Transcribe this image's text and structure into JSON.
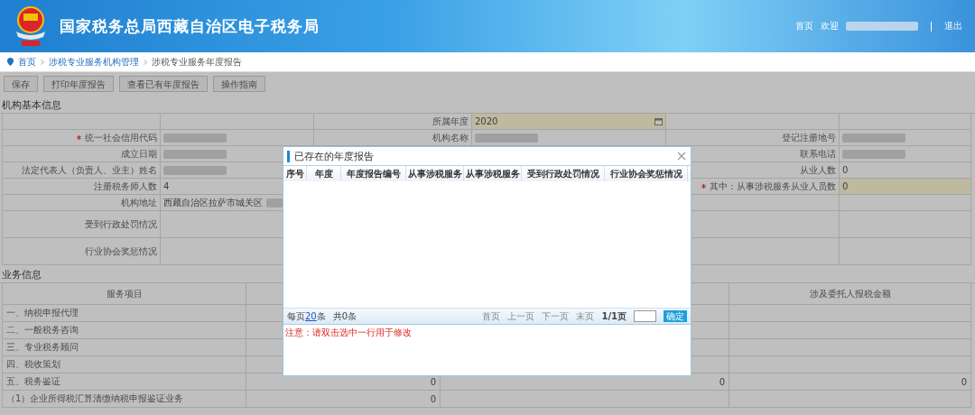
{
  "header": {
    "title": "国家税务总局西藏自治区电子税务局",
    "links": [
      {
        "label": "首页"
      },
      {
        "label": "欢迎"
      }
    ],
    "logout": "退出"
  },
  "breadcrumb": [
    {
      "label": "首页"
    },
    {
      "label": "涉税专业服务机构管理"
    },
    {
      "label": "涉税专业服务年度报告"
    }
  ],
  "toolbar": [
    {
      "label": "保存"
    },
    {
      "label": "打印年度报告"
    },
    {
      "label": "查看已有年度报告"
    },
    {
      "label": "操作指南"
    }
  ],
  "basic_info": {
    "title": "机构基本信息",
    "rows": [
      {
        "cells": [
          {},
          {
            "label": "所属年度",
            "value": "2020",
            "highlight": true,
            "calendar": true
          },
          {}
        ]
      },
      {
        "cells": [
          {
            "label": "统一社会信用代码",
            "required": true,
            "blurred": true
          },
          {
            "label": "机构名称",
            "blurred": true
          },
          {
            "label": "登记注册地号",
            "blurred": true
          }
        ]
      },
      {
        "cells": [
          {
            "label": "成立日期",
            "blurred": true
          },
          {},
          {
            "label": "联系电话",
            "blurred": true
          }
        ]
      },
      {
        "cells": [
          {
            "label": "法定代表人（负责人、业主）姓名",
            "blurred": true
          },
          {},
          {
            "label": "从业人数",
            "value": "0"
          }
        ]
      },
      {
        "cells": [
          {
            "label": "注册税务师人数",
            "value": "4"
          },
          {},
          {
            "label": "其中：从事涉税服务从业人员数",
            "value": "0",
            "required": true,
            "highlight": true
          }
        ]
      },
      {
        "cells": [
          {
            "label": "机构地址",
            "value": "西藏自治区拉萨市城关区",
            "blurred": true
          },
          {},
          {}
        ]
      },
      {
        "tall": true,
        "cells": [
          {
            "label": "受到行政处罚情况"
          },
          {},
          {}
        ]
      },
      {
        "tall": true,
        "cells": [
          {
            "label": "行业协会奖惩情况"
          },
          {},
          {}
        ]
      }
    ]
  },
  "business_info": {
    "title": "业务信息",
    "columns": [
      "服务项目",
      "涉及委托人报税金额"
    ],
    "rows": [
      {
        "label": "一、纳税申报代理",
        "values": []
      },
      {
        "label": "二、一般税务咨询",
        "values": []
      },
      {
        "label": "三、专业税务顾问",
        "values": []
      },
      {
        "label": "四、税收策划",
        "values": []
      },
      {
        "label": "五、税务鉴证",
        "values": [
          "0",
          "0",
          "0"
        ]
      },
      {
        "label": "（1）企业所得税汇算清缴纳税申报鉴证业务",
        "values": [
          "0"
        ]
      }
    ]
  },
  "dialog": {
    "title": "已存在的年度报告",
    "columns": [
      "序号",
      "年度",
      "年度报告编号",
      "从事涉税服务",
      "从事涉税服务",
      "受到行政处罚情况",
      "行业协会奖惩情况"
    ],
    "page_size_prefix": "每页",
    "page_size": "20",
    "page_size_suffix": "条",
    "total": "共0条",
    "pager": [
      {
        "label": "首页"
      },
      {
        "label": "上一页"
      },
      {
        "label": "下一页"
      },
      {
        "label": "末页"
      }
    ],
    "page_info": "1/1页",
    "go": "确定",
    "note": "注意：请双击选中一行用于修改"
  }
}
